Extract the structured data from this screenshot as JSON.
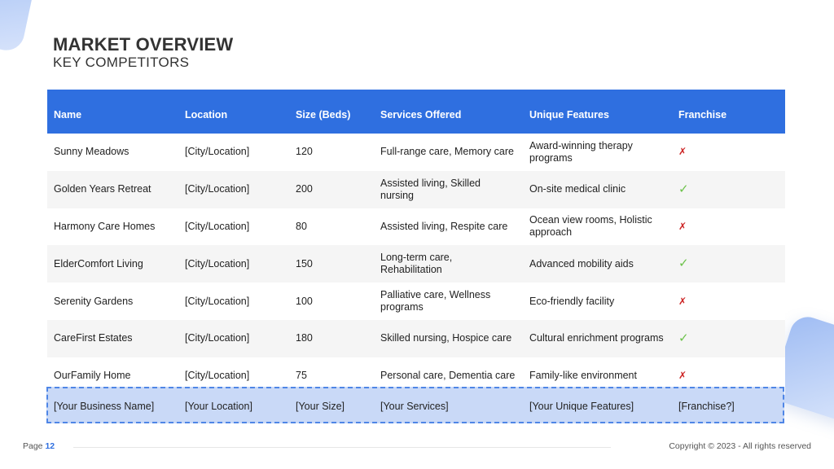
{
  "header": {
    "title": "MARKET OVERVIEW",
    "subtitle": "KEY COMPETITORS"
  },
  "table": {
    "columns": [
      "Name",
      "Location",
      "Size (Beds)",
      "Services Offered",
      "Unique Features",
      "Franchise"
    ],
    "rows": [
      {
        "name": "Sunny Meadows",
        "location": "[City/Location]",
        "size": "120",
        "services": "Full-range care, Memory care",
        "features": "Award-winning therapy programs",
        "franchise": "✗"
      },
      {
        "name": "Golden Years Retreat",
        "location": "[City/Location]",
        "size": "200",
        "services": "Assisted living, Skilled nursing",
        "features": "On-site medical clinic",
        "franchise": "✓"
      },
      {
        "name": "Harmony Care Homes",
        "location": "[City/Location]",
        "size": "80",
        "services": "Assisted living, Respite care",
        "features": "Ocean view rooms, Holistic approach",
        "franchise": "✗"
      },
      {
        "name": "ElderComfort Living",
        "location": "[City/Location]",
        "size": "150",
        "services": "Long-term care, Rehabilitation",
        "features": "Advanced mobility aids",
        "franchise": "✓"
      },
      {
        "name": "Serenity Gardens",
        "location": "[City/Location]",
        "size": "100",
        "services": "Palliative care, Wellness programs",
        "features": "Eco-friendly facility",
        "franchise": "✗"
      },
      {
        "name": "CareFirst Estates",
        "location": "[City/Location]",
        "size": "180",
        "services": "Skilled nursing, Hospice care",
        "features": "Cultural enrichment programs",
        "franchise": "✓"
      },
      {
        "name": "OurFamily Home",
        "location": "[City/Location]",
        "size": "75",
        "services": "Personal care, Dementia care",
        "features": "Family-like environment",
        "franchise": "✗"
      }
    ],
    "placeholder_row": {
      "name": "[Your Business Name]",
      "location": "[Your Location]",
      "size": "[Your Size]",
      "services": "[Your Services]",
      "features": "[Your Unique Features]",
      "franchise": "[Franchise?]"
    }
  },
  "footer": {
    "page_label": "Page",
    "page_number": "12",
    "copyright": "Copyright © 2023 - All rights reserved"
  },
  "colors": {
    "accent": "#2f6fe0",
    "yes": "#6cc24a",
    "no": "#cc2222",
    "highlight": "#c9d9f7"
  }
}
